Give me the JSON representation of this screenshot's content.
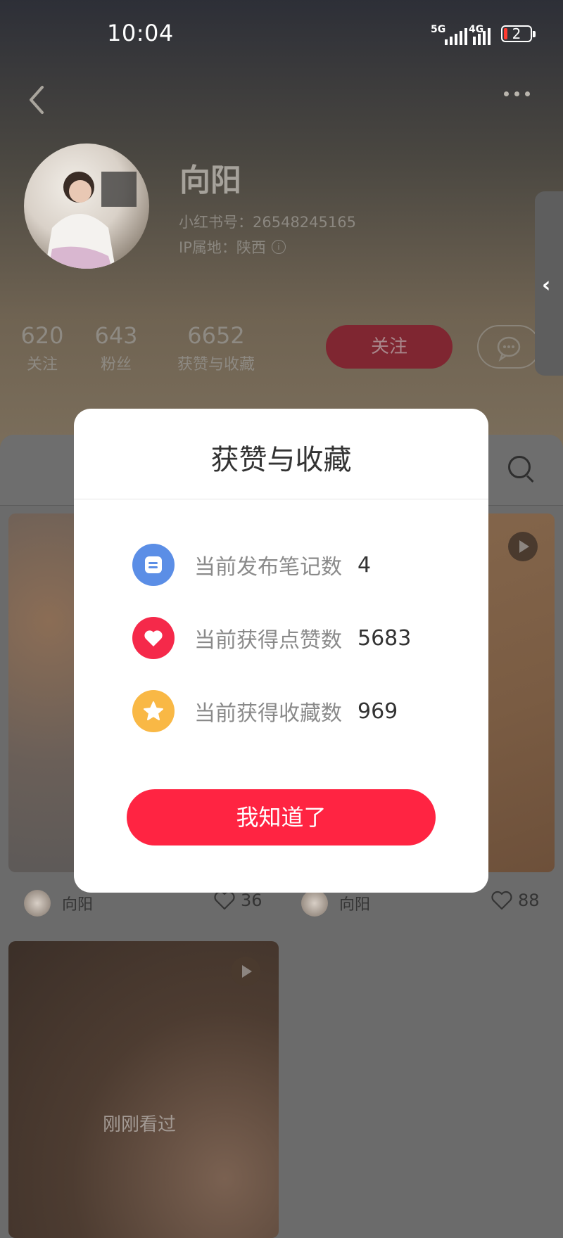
{
  "status": {
    "time": "10:04",
    "net1": "5G",
    "net2": "4G",
    "battery": "2"
  },
  "profile": {
    "name": "向阳",
    "red_id": "小红书号：26548245165",
    "ip": "IP属地：陕西",
    "info_icon": "i",
    "stats": [
      {
        "value": "620",
        "label": "关注"
      },
      {
        "value": "643",
        "label": "粉丝"
      },
      {
        "value": "6652",
        "label": "获赞与收藏"
      }
    ],
    "follow_label": "关注"
  },
  "feed": {
    "cards": [
      {
        "author": "向阳",
        "likes": "36"
      },
      {
        "author": "向阳",
        "likes": "88"
      }
    ],
    "recent_label": "刚刚看过"
  },
  "dialog": {
    "title": "获赞与收藏",
    "rows": [
      {
        "label": "当前发布笔记数",
        "value": "4",
        "icon": "note-icon"
      },
      {
        "label": "当前获得点赞数",
        "value": "5683",
        "icon": "heart-icon"
      },
      {
        "label": "当前获得收藏数",
        "value": "969",
        "icon": "star-icon"
      }
    ],
    "button_label": "我知道了"
  },
  "colors": {
    "accent": "#ff2442",
    "blue": "#5b8ee6",
    "red": "#f5294a",
    "yellow": "#f9b845"
  }
}
